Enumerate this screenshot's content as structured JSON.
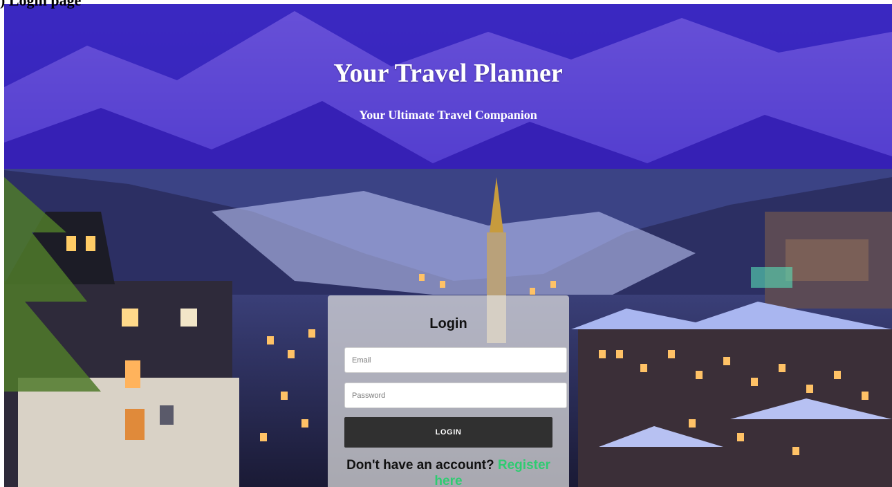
{
  "page": {
    "caption": ") Login page"
  },
  "banner": {
    "title": "Your Travel Planner",
    "subtitle": "Your Ultimate Travel Companion"
  },
  "login": {
    "title": "Login",
    "email_placeholder": "Email",
    "password_placeholder": "Password",
    "button_label": "LOGIN",
    "register_prompt": "Don't have an account?",
    "register_link": "Register here"
  },
  "colors": {
    "banner_overlay": "#3414c8",
    "button_bg": "#303030",
    "link_green": "#2ecc71",
    "card_bg": "#e1e1e1"
  }
}
